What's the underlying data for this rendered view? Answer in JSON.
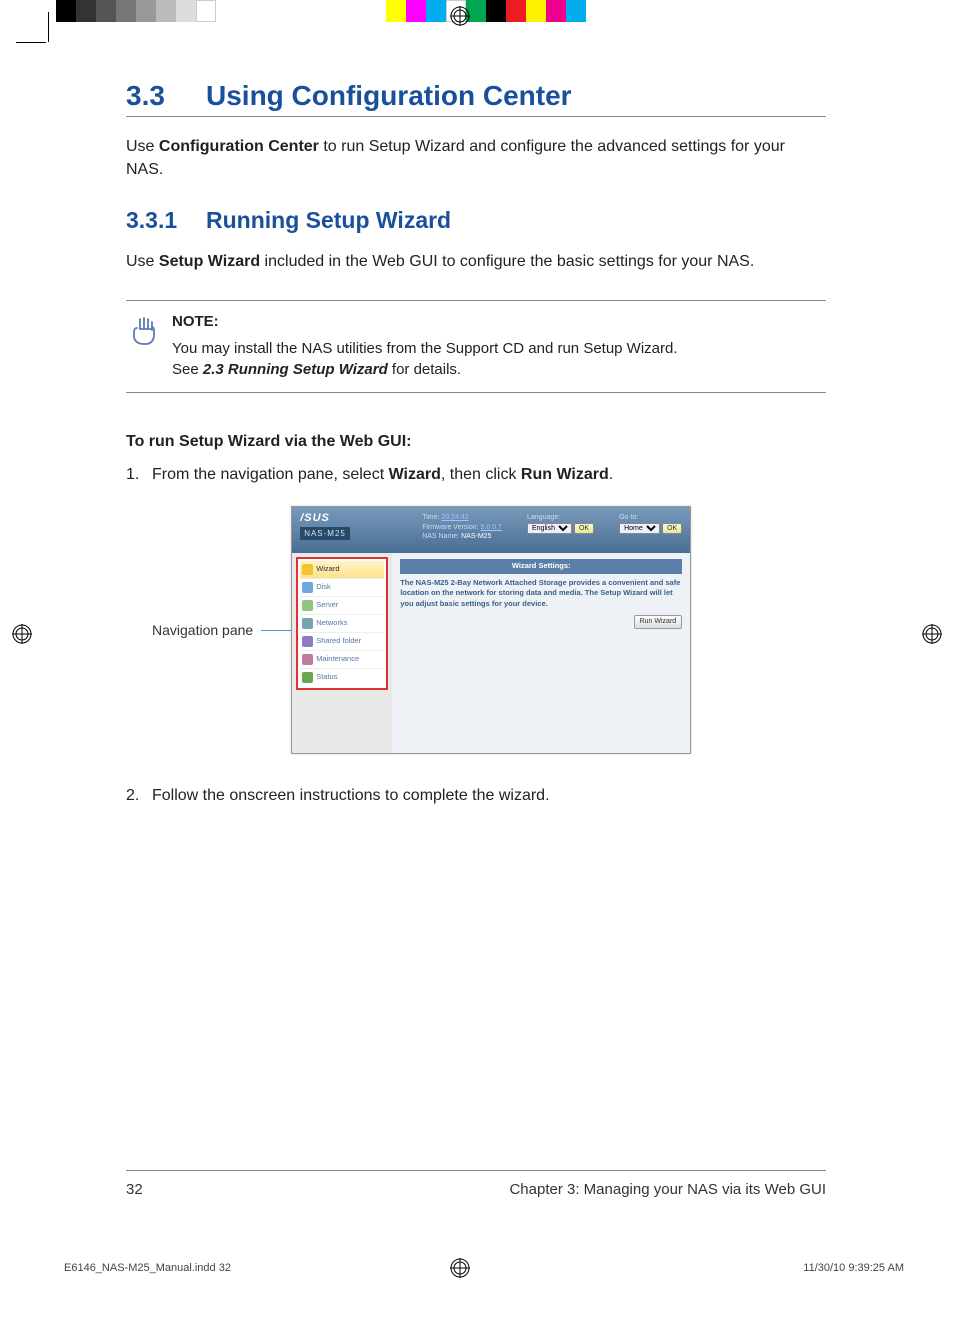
{
  "registration_colors": [
    "#000000",
    "#333333",
    "#555555",
    "#777777",
    "#999999",
    "#bbbbbb",
    "#dddddd",
    "#ffffff",
    "#ffff00",
    "#ff00ff",
    "#00aeef",
    "#ffffff",
    "#00a651",
    "#000000",
    "#ed1c24",
    "#fff200",
    "#ec008c",
    "#00aeef"
  ],
  "section": {
    "number": "3.3",
    "title": "Using Configuration Center"
  },
  "intro": {
    "prefix": "Use ",
    "bold": "Configuration Center",
    "suffix": " to run Setup Wizard and configure the advanced settings for your NAS."
  },
  "subsection": {
    "number": "3.3.1",
    "title": "Running Setup Wizard"
  },
  "sub_intro": {
    "prefix": "Use ",
    "bold": "Setup Wizard",
    "suffix": " included in the Web GUI to configure the basic settings for your NAS."
  },
  "note": {
    "label": "NOTE:",
    "line1": "You may install the NAS utilities from the Support CD and run Setup Wizard.",
    "line2a": "See ",
    "ref": "2.3 Running Setup Wizard",
    "line2b": " for details."
  },
  "procedure_heading": "To run Setup Wizard via the Web GUI:",
  "steps": {
    "s1": {
      "prefix": "From the navigation pane, select ",
      "b1": "Wizard",
      "mid": ", then click ",
      "b2": "Run Wizard",
      "suffix": "."
    },
    "s2": "Follow the onscreen instructions to complete the wizard."
  },
  "callout": "Navigation pane",
  "screenshot": {
    "logo": "/SUS",
    "model": "NAS-M25",
    "info": {
      "time_label": "Time:",
      "time_value": "20:24:42",
      "fw_label": "Firmware Version:",
      "fw_value": "5.0.0.7",
      "name_label": "NAS Name:",
      "name_value": "NAS-M25",
      "lang_label": "Language:",
      "lang_value": "English",
      "goto_label": "Go to:",
      "goto_value": "Home",
      "ok": "OK"
    },
    "nav_items": [
      "Wizard",
      "Disk",
      "Server",
      "Networks",
      "Shared folder",
      "Maintenance",
      "Status"
    ],
    "panel_title": "Wizard Settings:",
    "panel_desc": "The NAS-M25 2-Bay Network Attached Storage provides a convenient and safe location on the network for storing data and media. The Setup Wizard will let you adjust basic settings for your device.",
    "run_button": "Run Wizard"
  },
  "footer": {
    "page": "32",
    "chapter": "Chapter 3: Managing your NAS via its Web GUI"
  },
  "imprint": {
    "file": "E6146_NAS-M25_Manual.indd   32",
    "stamp": "11/30/10   9:39:25 AM"
  }
}
